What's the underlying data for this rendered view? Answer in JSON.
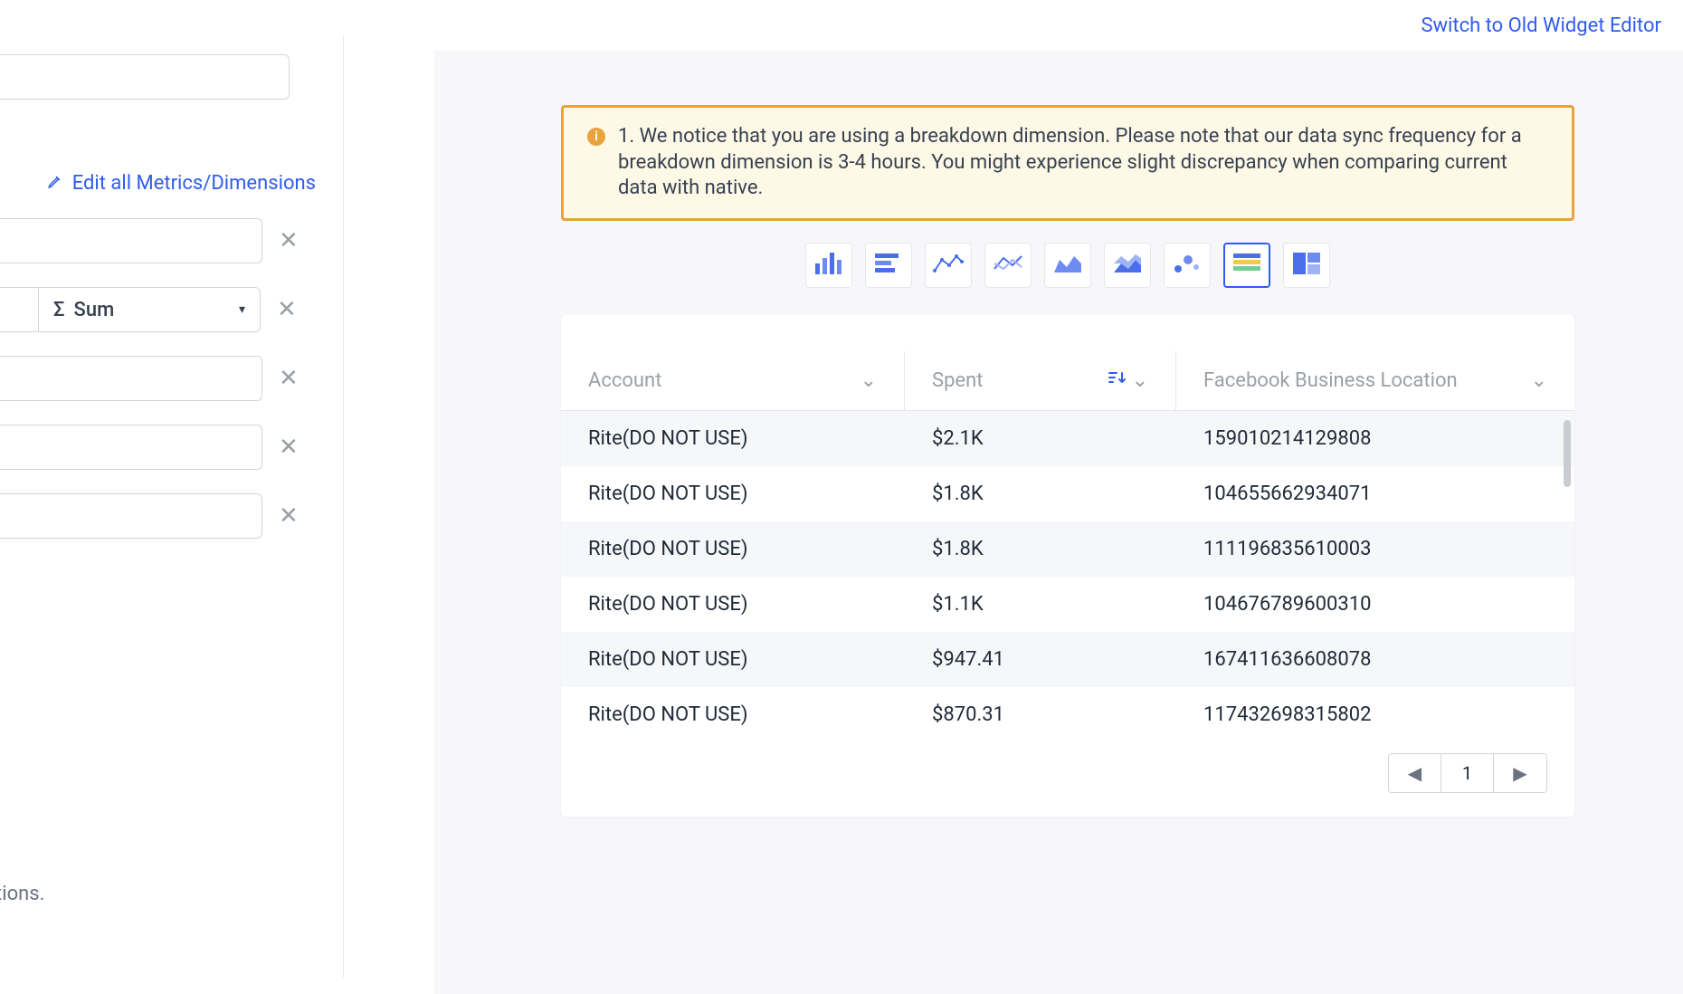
{
  "header": {
    "switch_link": "Switch to Old Widget Editor"
  },
  "sidebar": {
    "edit_all": "Edit all Metrics/Dimensions",
    "sum_label": "Sum",
    "footer_fragment": "ese options."
  },
  "alert": {
    "message": "1. We notice that you are using a breakdown dimension. Please note that our data sync frequency for a breakdown dimension is 3-4 hours. You might experience slight discrepancy when comparing current data with native."
  },
  "chart_types": {
    "selected_index": 7,
    "names": [
      "bar-chart-icon",
      "horizontal-bar-icon",
      "line-chart-icon",
      "multi-line-icon",
      "area-chart-icon",
      "stacked-area-icon",
      "scatter-chart-icon",
      "table-chart-icon",
      "treemap-chart-icon"
    ]
  },
  "table": {
    "columns": [
      {
        "label": "Account"
      },
      {
        "label": "Spent",
        "sorted": true
      },
      {
        "label": "Facebook Business Location"
      }
    ],
    "rows": [
      {
        "account": "Rite(DO NOT USE)",
        "spent": "$2.1K",
        "location": "159010214129808"
      },
      {
        "account": "Rite(DO NOT USE)",
        "spent": "$1.8K",
        "location": "104655662934071"
      },
      {
        "account": "Rite(DO NOT USE)",
        "spent": "$1.8K",
        "location": "111196835610003"
      },
      {
        "account": "Rite(DO NOT USE)",
        "spent": "$1.1K",
        "location": "104676789600310"
      },
      {
        "account": "Rite(DO NOT USE)",
        "spent": "$947.41",
        "location": "167411636608078"
      },
      {
        "account": "Rite(DO NOT USE)",
        "spent": "$870.31",
        "location": "117432698315802"
      }
    ]
  },
  "pagination": {
    "current": "1"
  }
}
